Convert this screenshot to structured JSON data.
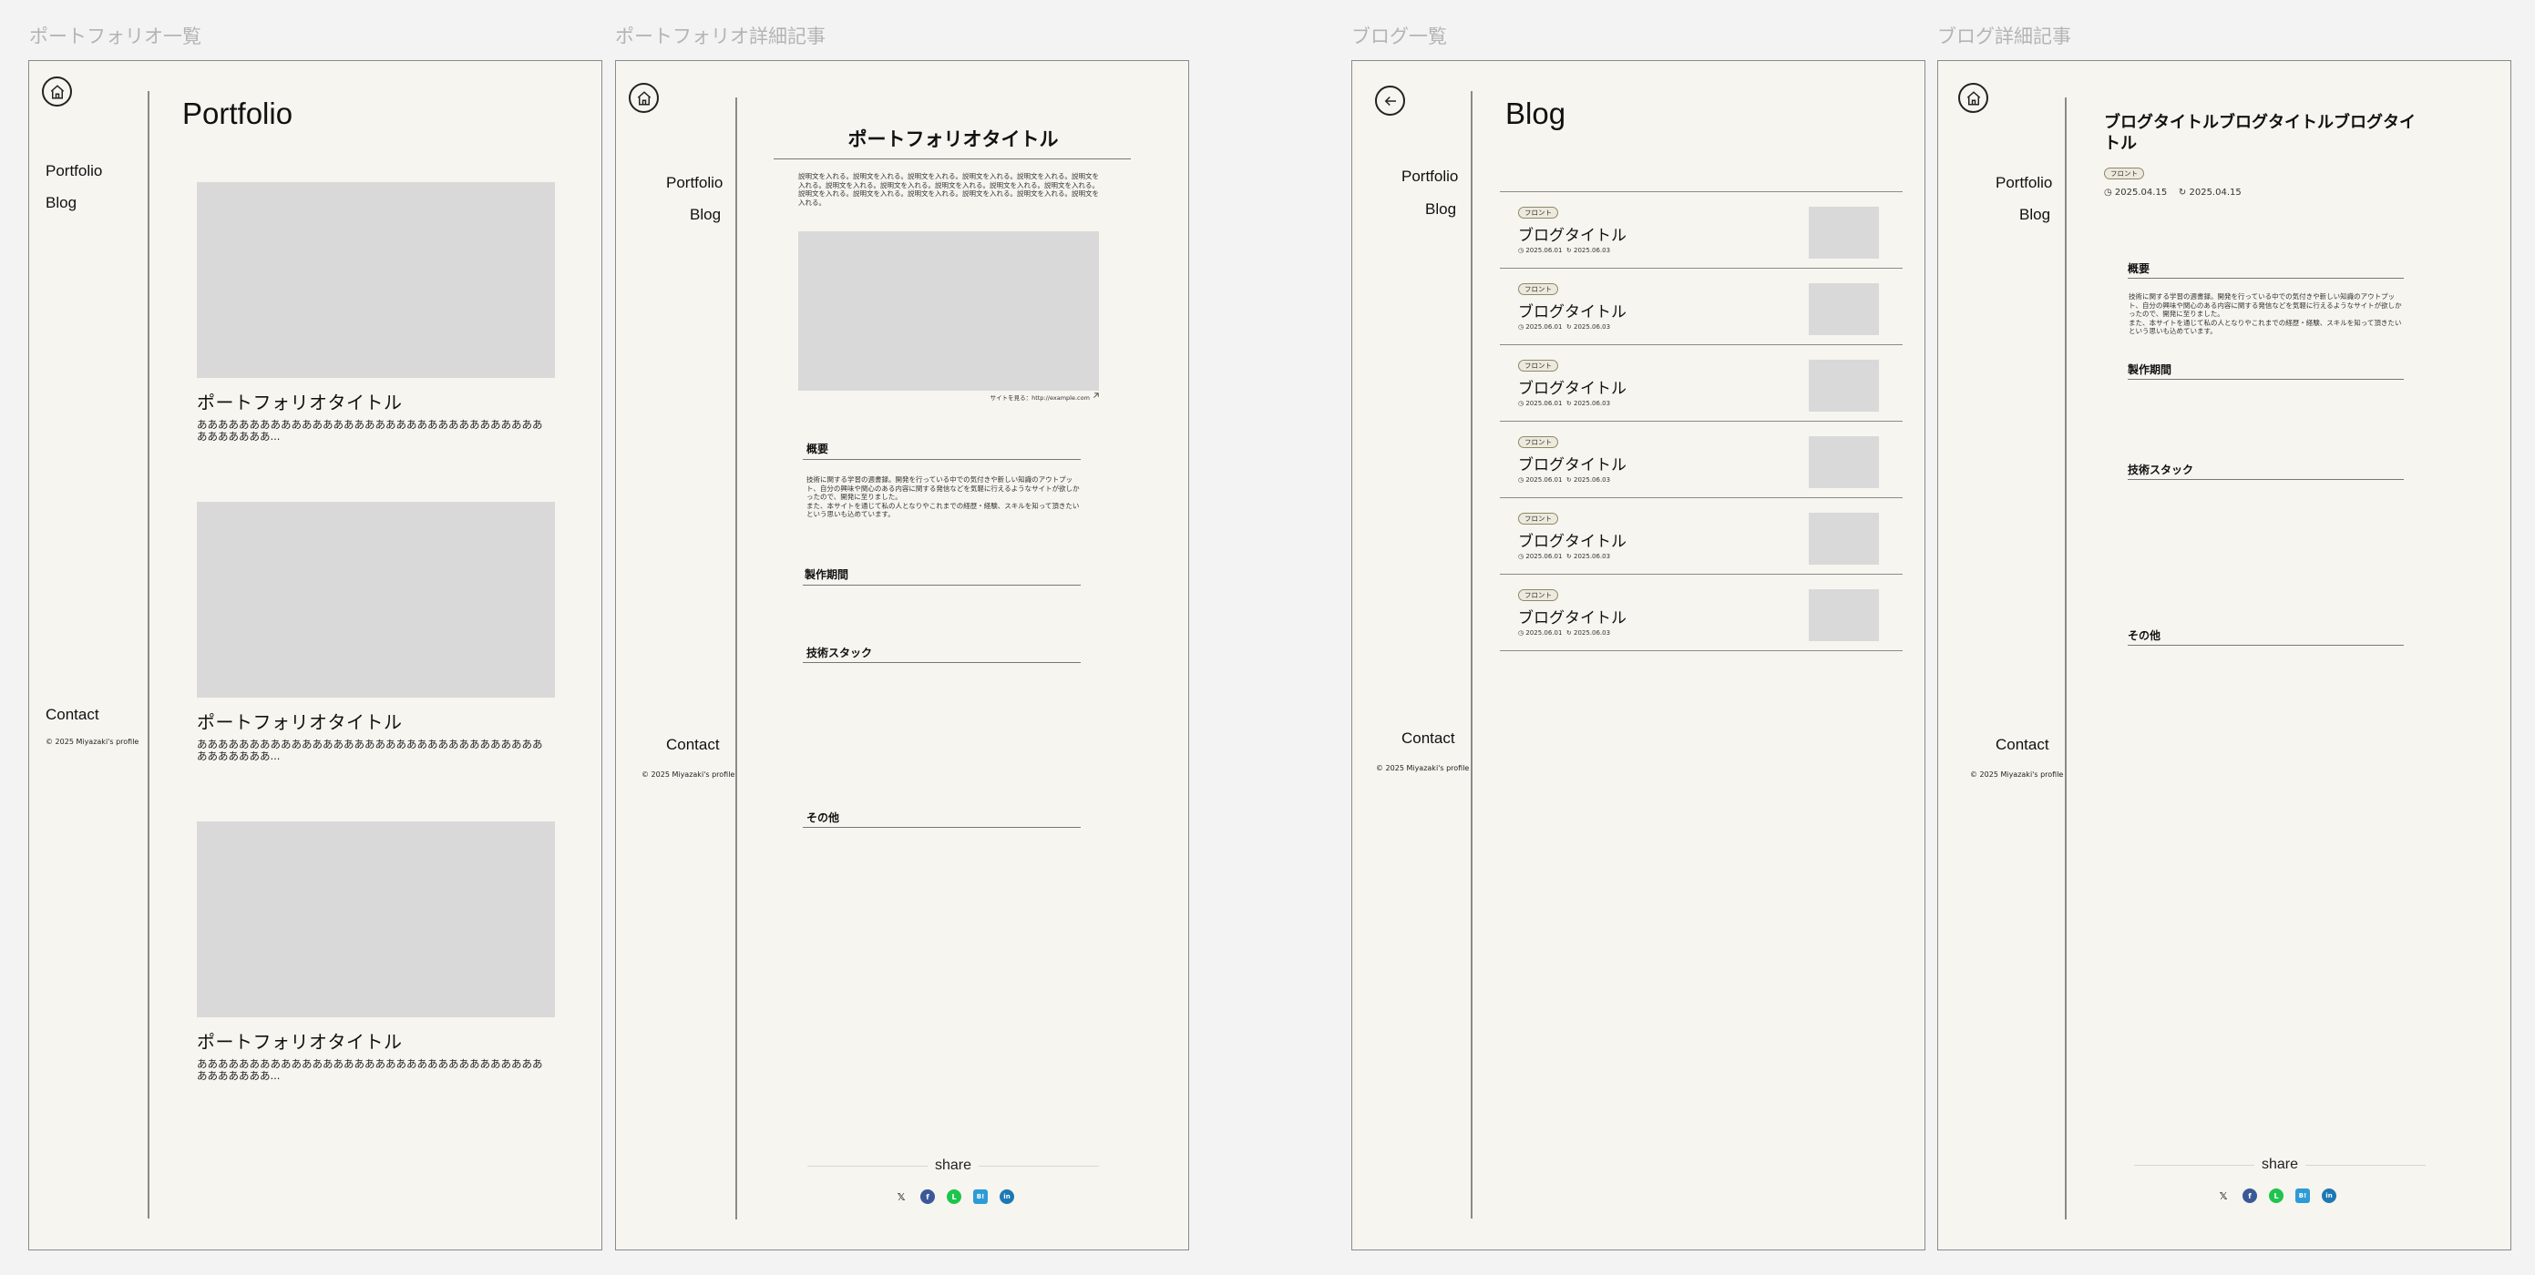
{
  "frames": {
    "portfolio_list": "ポートフォリオ一覧",
    "portfolio_detail": "ポートフォリオ詳細記事",
    "blog_list": "ブログ一覧",
    "blog_detail": "ブログ詳細記事"
  },
  "nav": {
    "portfolio": "Portfolio",
    "blog": "Blog",
    "contact": "Contact",
    "copyright": "© 2025 Miyazaki's profile"
  },
  "portfolio_list": {
    "heading": "Portfolio",
    "items": [
      {
        "title": "ポートフォリオタイトル",
        "desc": "ああああああああああああああああああああああああああああああああああああああああ..."
      },
      {
        "title": "ポートフォリオタイトル",
        "desc": "ああああああああああああああああああああああああああああああああああああああああ..."
      },
      {
        "title": "ポートフォリオタイトル",
        "desc": "ああああああああああああああああああああああああああああああああああああああああ..."
      }
    ]
  },
  "portfolio_detail": {
    "title": "ポートフォリオタイトル",
    "lead": "説明文を入れる。説明文を入れる。説明文を入れる。説明文を入れる。説明文を入れる。説明文を入れる。説明文を入れる。説明文を入れる。説明文を入れる。説明文を入れる。説明文を入れる。説明文を入れる。説明文を入れる。説明文を入れる。説明文を入れる。説明文を入れる。説明文を入れる。",
    "site_link": "サイトを見る：http://example.com",
    "sections": {
      "overview": "概要",
      "period": "製作期間",
      "stack": "技術スタック",
      "other": "その他"
    },
    "overview_text": "技術に関する学習の週書録。開発を行っている中での気付きや新しい知識のアウトプット、自分の興味や関心のある内容に関する発信などを気軽に行えるようなサイトが欲しかったので、開発に至りました。\nまた、本サイトを通じて私の人となりやこれまでの経歴・経験、スキルを知って頂きたいという思いも込めています。",
    "share": "share"
  },
  "blog_list": {
    "heading": "Blog",
    "posts": [
      {
        "tag": "フロント",
        "title": "ブログタイトル",
        "created": "2025.06.01",
        "updated": "2025.06.03"
      },
      {
        "tag": "フロント",
        "title": "ブログタイトル",
        "created": "2025.06.01",
        "updated": "2025.06.03"
      },
      {
        "tag": "フロント",
        "title": "ブログタイトル",
        "created": "2025.06.01",
        "updated": "2025.06.03"
      },
      {
        "tag": "フロント",
        "title": "ブログタイトル",
        "created": "2025.06.01",
        "updated": "2025.06.03"
      },
      {
        "tag": "フロント",
        "title": "ブログタイトル",
        "created": "2025.06.01",
        "updated": "2025.06.03"
      },
      {
        "tag": "フロント",
        "title": "ブログタイトル",
        "created": "2025.06.01",
        "updated": "2025.06.03"
      }
    ]
  },
  "blog_detail": {
    "title": "ブログタイトルブログタイトルブログタイトル",
    "tag": "フロント",
    "created": "2025.04.15",
    "updated": "2025.04.15",
    "sections": {
      "overview": "概要",
      "period": "製作期間",
      "stack": "技術スタック",
      "other": "その他"
    },
    "overview_text": "技術に関する学習の週書録。開発を行っている中での気付きや新しい知識のアウトプット、自分の興味や関心のある内容に関する発信などを気軽に行えるようなサイトが欲しかったので、開発に至りました。\nまた、本サイトを通じて私の人となりやこれまでの経歴・経験、スキルを知って頂きたいという思いも込めています。",
    "share": "share"
  },
  "share_icons": [
    {
      "name": "x-icon",
      "glyph": "𝕏",
      "color": "#f7f5f0"
    },
    {
      "name": "facebook-icon",
      "glyph": "f",
      "color": "#3b5998"
    },
    {
      "name": "line-icon",
      "glyph": "L",
      "color": "#1ec54c"
    },
    {
      "name": "hatena-icon",
      "glyph": "B!",
      "color": "#2e9bd6"
    },
    {
      "name": "linkedin-icon",
      "glyph": "in",
      "color": "#1d78b4"
    }
  ]
}
